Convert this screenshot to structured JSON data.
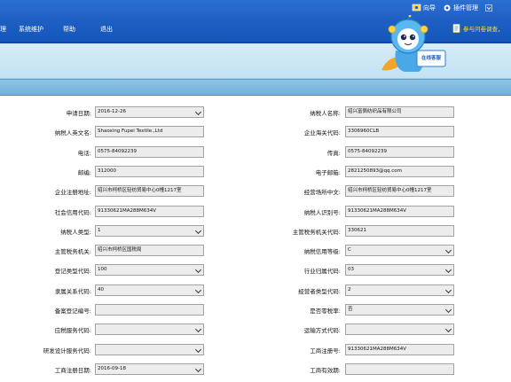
{
  "header": {
    "top_links": [
      {
        "label": "向导",
        "icon": "guide-icon"
      },
      {
        "label": "插件管理",
        "icon": "plugin-icon"
      },
      {
        "label": "",
        "icon": "dropdown-arrow-icon"
      }
    ],
    "nav": [
      "理",
      "系统维护",
      "帮助",
      "退出"
    ],
    "survey_text": "参与问卷调查，",
    "mascot_sign": "在线客服"
  },
  "form": {
    "rows": [
      {
        "left_label": "申请日期:",
        "left_value": "2016-12-26",
        "left_select": true,
        "right_label": "纳税人名称:",
        "right_value": "绍兴富佩纺织品有限公司",
        "right_select": false
      },
      {
        "left_label": "纳税人英文名:",
        "left_value": "Shaoxing Fupei Textile.,Ltd",
        "left_select": false,
        "right_label": "企业海关代码:",
        "right_value": "3306960CLB",
        "right_select": false
      },
      {
        "left_label": "电话:",
        "left_value": "0575-84092239",
        "left_select": false,
        "right_label": "传真:",
        "right_value": "0575-84092239",
        "right_select": false
      },
      {
        "left_label": "邮编:",
        "left_value": "312000",
        "left_select": false,
        "right_label": "电子邮箱:",
        "right_value": "2821250893@qq.com",
        "right_select": false
      },
      {
        "left_label": "企业注册地址:",
        "left_value": "绍兴市柯桥区轻纺贸易中心0幢1217室",
        "left_select": false,
        "right_label": "经营场所中文:",
        "right_value": "绍兴市柯桥区轻纺贸易中心0幢1217室",
        "right_select": false
      },
      {
        "left_label": "社会信用代码:",
        "left_value": "91330621MA288M634V",
        "left_select": false,
        "right_label": "纳税人识别号:",
        "right_value": "91330621MA288M634V",
        "right_select": false
      },
      {
        "left_label": "纳税人类型:",
        "left_value": "1",
        "left_select": true,
        "right_label": "主管税务机关代码:",
        "right_value": "330621",
        "right_select": false
      },
      {
        "left_label": "主管税务机关:",
        "left_value": "绍兴市柯桥区国税局",
        "left_select": false,
        "right_label": "纳税信用等级:",
        "right_value": "C",
        "right_select": true
      },
      {
        "left_label": "登记类型代码:",
        "left_value": "100",
        "left_select": true,
        "right_label": "行业归属代码:",
        "right_value": "03",
        "right_select": true
      },
      {
        "left_label": "隶属关系代码:",
        "left_value": "40",
        "left_select": true,
        "right_label": "经营者类型代码:",
        "right_value": "2",
        "right_select": true
      },
      {
        "left_label": "备案登记编号:",
        "left_value": "",
        "left_select": false,
        "right_label": "是否零税率:",
        "right_value": "否",
        "right_select": true
      },
      {
        "left_label": "应税服务代码:",
        "left_value": "",
        "left_select": true,
        "right_label": "运输方式代码:",
        "right_value": "",
        "right_select": true
      },
      {
        "left_label": "研发设计服务代码:",
        "left_value": "",
        "left_select": true,
        "right_label": "工商注册号:",
        "right_value": "91330621MA288M634V",
        "right_select": false
      },
      {
        "left_label": "工商注册日期:",
        "left_value": "2016-09-18",
        "left_select": true,
        "right_label": "工商有效期:",
        "right_value": "",
        "right_select": false
      }
    ]
  }
}
